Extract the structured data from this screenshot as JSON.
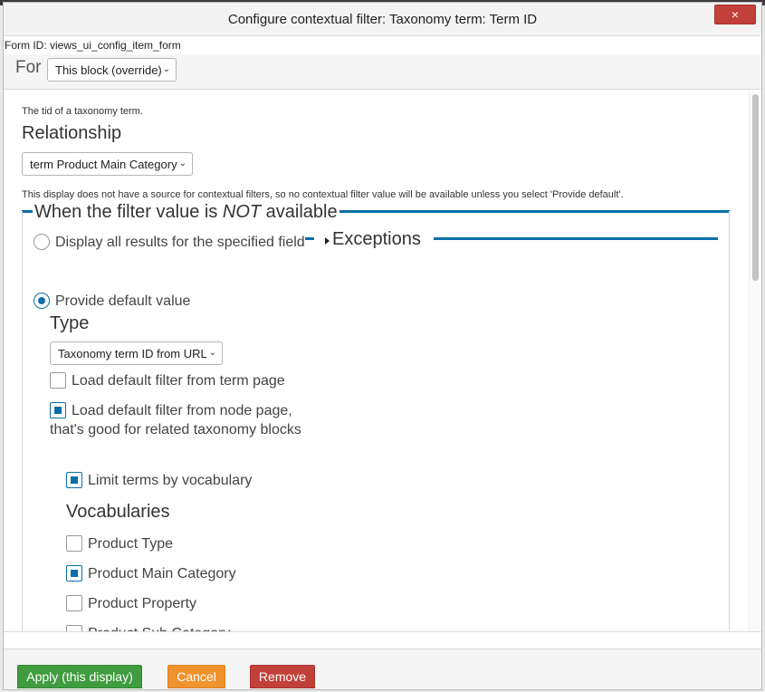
{
  "dialog": {
    "title": "Configure contextual filter: Taxonomy term: Term ID",
    "close_icon": "×",
    "form_id": "Form ID: views_ui_config_item_form"
  },
  "for_bar": {
    "label": "For",
    "selected": "This block (override)"
  },
  "content": {
    "description": "The tid of a taxonomy term.",
    "relationship_heading": "Relationship",
    "relationship_selected": "term Product Main Category",
    "notice": "This display does not have a source for contextual filters, so no contextual filter value will be available unless you select 'Provide default'.",
    "fieldset_legend_before": "When the filter value is ",
    "fieldset_legend_em": "NOT",
    "fieldset_legend_after": " available",
    "radio_display_all": "Display all results for the specified field",
    "radio_provide_default": "Provide default value",
    "type_heading": "Type",
    "type_selected": "Taxonomy term ID from URL",
    "cb_term_page": "Load default filter from term page",
    "cb_node_page": "Load default filter from node page, that's good for related taxonomy blocks",
    "cb_limit_terms": "Limit terms by vocabulary",
    "vocabularies_heading": "Vocabularies",
    "vocabularies": [
      {
        "label": "Product Type",
        "checked": false
      },
      {
        "label": "Product Main Category",
        "checked": true
      },
      {
        "label": "Product Property",
        "checked": false
      },
      {
        "label": "Product Sub Category",
        "checked": false
      }
    ],
    "exceptions_label": "Exceptions"
  },
  "footer": {
    "apply_label": "Apply (this display)",
    "cancel_label": "Cancel",
    "remove_label": "Remove"
  },
  "colors": {
    "accent": "#0a6fa8",
    "apply": "#3f9c3f",
    "cancel": "#f0932f",
    "remove": "#c2403a"
  }
}
